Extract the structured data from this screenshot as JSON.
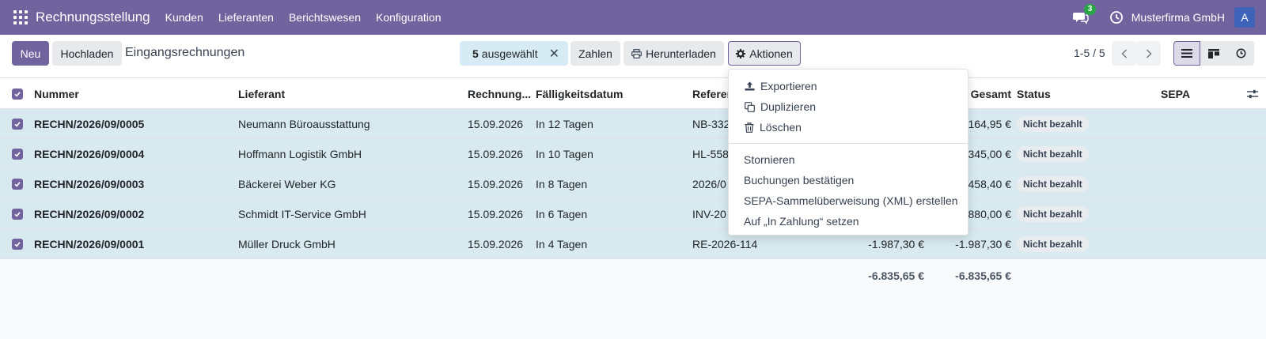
{
  "navbar": {
    "app_title": "Rechnungsstellung",
    "menu": [
      "Kunden",
      "Lieferanten",
      "Berichtswesen",
      "Konfiguration"
    ],
    "chat_count": "3",
    "company": "Musterfirma GmbH",
    "avatar_letter": "A",
    "background": "#71639e"
  },
  "controls": {
    "new_label": "Neu",
    "upload_label": "Hochladen",
    "breadcrumb": "Eingangsrechnungen",
    "selected_count": "5",
    "selected_label": "ausgewählt",
    "pay_label": "Zahlen",
    "download_label": "Herunterladen",
    "actions_label": "Aktionen",
    "pager": "1-5 / 5"
  },
  "table": {
    "headers": {
      "number": "Nummer",
      "supplier": "Lieferant",
      "invoice_date": "Rechnung...",
      "due_date": "Fälligkeitsdatum",
      "reference": "Referen",
      "total": "Gesamt",
      "status": "Status",
      "sepa": "SEPA"
    },
    "rows": [
      {
        "number": "RECHN/2026/09/0005",
        "supplier": "Neumann Büroausstattung",
        "date": "15.09.2026",
        "due": "In 12 Tagen",
        "ref": "NB-332",
        "net": "",
        "total": "164,95 €",
        "status": "Nicht bezahlt"
      },
      {
        "number": "RECHN/2026/09/0004",
        "supplier": "Hoffmann Logistik GmbH",
        "date": "15.09.2026",
        "due": "In 10 Tagen",
        "ref": "HL-558",
        "net": "",
        "total": "345,00 €",
        "status": "Nicht bezahlt"
      },
      {
        "number": "RECHN/2026/09/0003",
        "supplier": "Bäckerei Weber KG",
        "date": "15.09.2026",
        "due": "In 8 Tagen",
        "ref": "2026/0",
        "net": "",
        "total": "458,40 €",
        "status": "Nicht bezahlt"
      },
      {
        "number": "RECHN/2026/09/0002",
        "supplier": "Schmidt IT-Service GmbH",
        "date": "15.09.2026",
        "due": "In 6 Tagen",
        "ref": "INV-20",
        "net": "",
        "total": "880,00 €",
        "status": "Nicht bezahlt"
      },
      {
        "number": "RECHN/2026/09/0001",
        "supplier": "Müller Druck GmbH",
        "date": "15.09.2026",
        "due": "In 4 Tagen",
        "ref": "RE-2026-114",
        "net": "-1.987,30 €",
        "total": "-1.987,30 €",
        "status": "Nicht bezahlt"
      }
    ],
    "sum_net": "-6.835,65 €",
    "sum_total": "-6.835,65 €"
  },
  "dropdown": {
    "export": "Exportieren",
    "duplicate": "Duplizieren",
    "delete": "Löschen",
    "cancel": "Stornieren",
    "confirm": "Buchungen bestätigen",
    "sepa": "SEPA-Sammelüberweisung (XML) erstellen",
    "in_payment": "Auf „In Zahlung“ setzen"
  }
}
